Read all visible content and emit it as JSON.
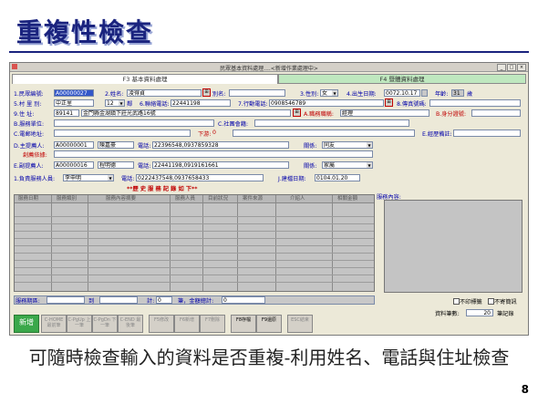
{
  "slide": {
    "title": "重複性檢查",
    "caption": "可隨時檢查輸入的資料是否重複-利用姓名、電話與住址檢查",
    "page_number": "8"
  },
  "window": {
    "title": "民眾基本資料處理....<新增作業處理中>",
    "tab1": "F3 基本資料處理",
    "tab2": "F4 暨體資料處理"
  },
  "form": {
    "id_label": "1.民眾編號:",
    "id_value": "A00000027",
    "name_label": "2.姓名:",
    "name_value": "凌得貞",
    "alias_label": "別名:",
    "sex_label": "3.性別:",
    "sex_value": "女",
    "birth_label": "4.出生日期:",
    "birth_value": "0072.10.17",
    "age_label": "年齡:",
    "age_value": "31",
    "age_unit": "歲",
    "village_label": "5.村 里 別:",
    "village_value": "中正里",
    "neighbor_value": "12",
    "neighbor_unit": "鄰",
    "phone_label": "6.聯絡電話:",
    "phone_value": "22441198",
    "mobile_label": "7.行動電話:",
    "mobile_value": "0908546789",
    "fax_label": "8.傳真號碼:",
    "addr_label": "9.住 址:",
    "addr_zip": "89141",
    "addr_value": "金門縣金湖鎮下莊光武路16號",
    "occupation_label": "A.職務職稱:",
    "occupation_value": "經理",
    "idcard_label": "B.身分證號:",
    "service_unit_label": "B.服務單位:",
    "community_label": "C.社團會籍:",
    "email_label": "C.電郵地址:",
    "debt_label": "下游:",
    "debt_value": "0",
    "misc_label": "E.經歷備註:",
    "primary_label": "D.主提薦人:",
    "primary_id": "A00000001",
    "primary_name": "陳嘉豪",
    "primary_phone_label": "電話:",
    "primary_phone": "22396548,0937859328",
    "primary_rel_label": "關係:",
    "primary_rel": "同友",
    "intro_label": "創薦依據:",
    "secondary_label": "E.副提薦人:",
    "secondary_id": "A00000016",
    "secondary_name": "程明德",
    "secondary_phone_label": "電話:",
    "secondary_phone": "22441198,0919161661",
    "secondary_rel_label": "關係:",
    "secondary_rel": "家屬",
    "staff_label": "1.負責服務人員:",
    "staff_value": "李申明",
    "staff_phone_label": "電話:",
    "staff_phone": "0222437548,0937658433",
    "created_label": "J.建檔日期:",
    "created_value": "0104.01.20",
    "history_title": "**歷 史 服 務 記 錄 如 下**",
    "content_label": "服務內容:"
  },
  "grid": {
    "columns": [
      "服務日期",
      "服務類別",
      "服務內容摘要",
      "服務人員",
      "目前狀況",
      "案件來源",
      "介紹人",
      "相關金額"
    ],
    "footer_period_label": "服務期區:",
    "footer_to": "到",
    "footer_count_label": "計:",
    "footer_count": "0",
    "footer_total_label": "筆，金額總計:",
    "footer_total": "0"
  },
  "checkboxes": {
    "noprint": "不印標籤",
    "nosend": "不寄簡訊"
  },
  "records": {
    "label": "資料筆數:",
    "value": "20",
    "unit": "筆記錄"
  },
  "toolbar": {
    "new": "新增",
    "btn1": "C-HOME 最前筆",
    "btn2": "C-PgUp 上一筆",
    "btn3": "C-PgDn 下一筆",
    "btn4": "C-END 最後筆",
    "btn5": "F5修改",
    "btn6": "F6新增",
    "btn7": "F7刪除",
    "btn8": "F8存檔",
    "btn9": "F9還原",
    "btn10": "ESC結束"
  },
  "colors": {
    "title": "#1a237e",
    "highlight": "#c00000",
    "selected": "#3357c9",
    "tab2": "#bfe8bf"
  }
}
